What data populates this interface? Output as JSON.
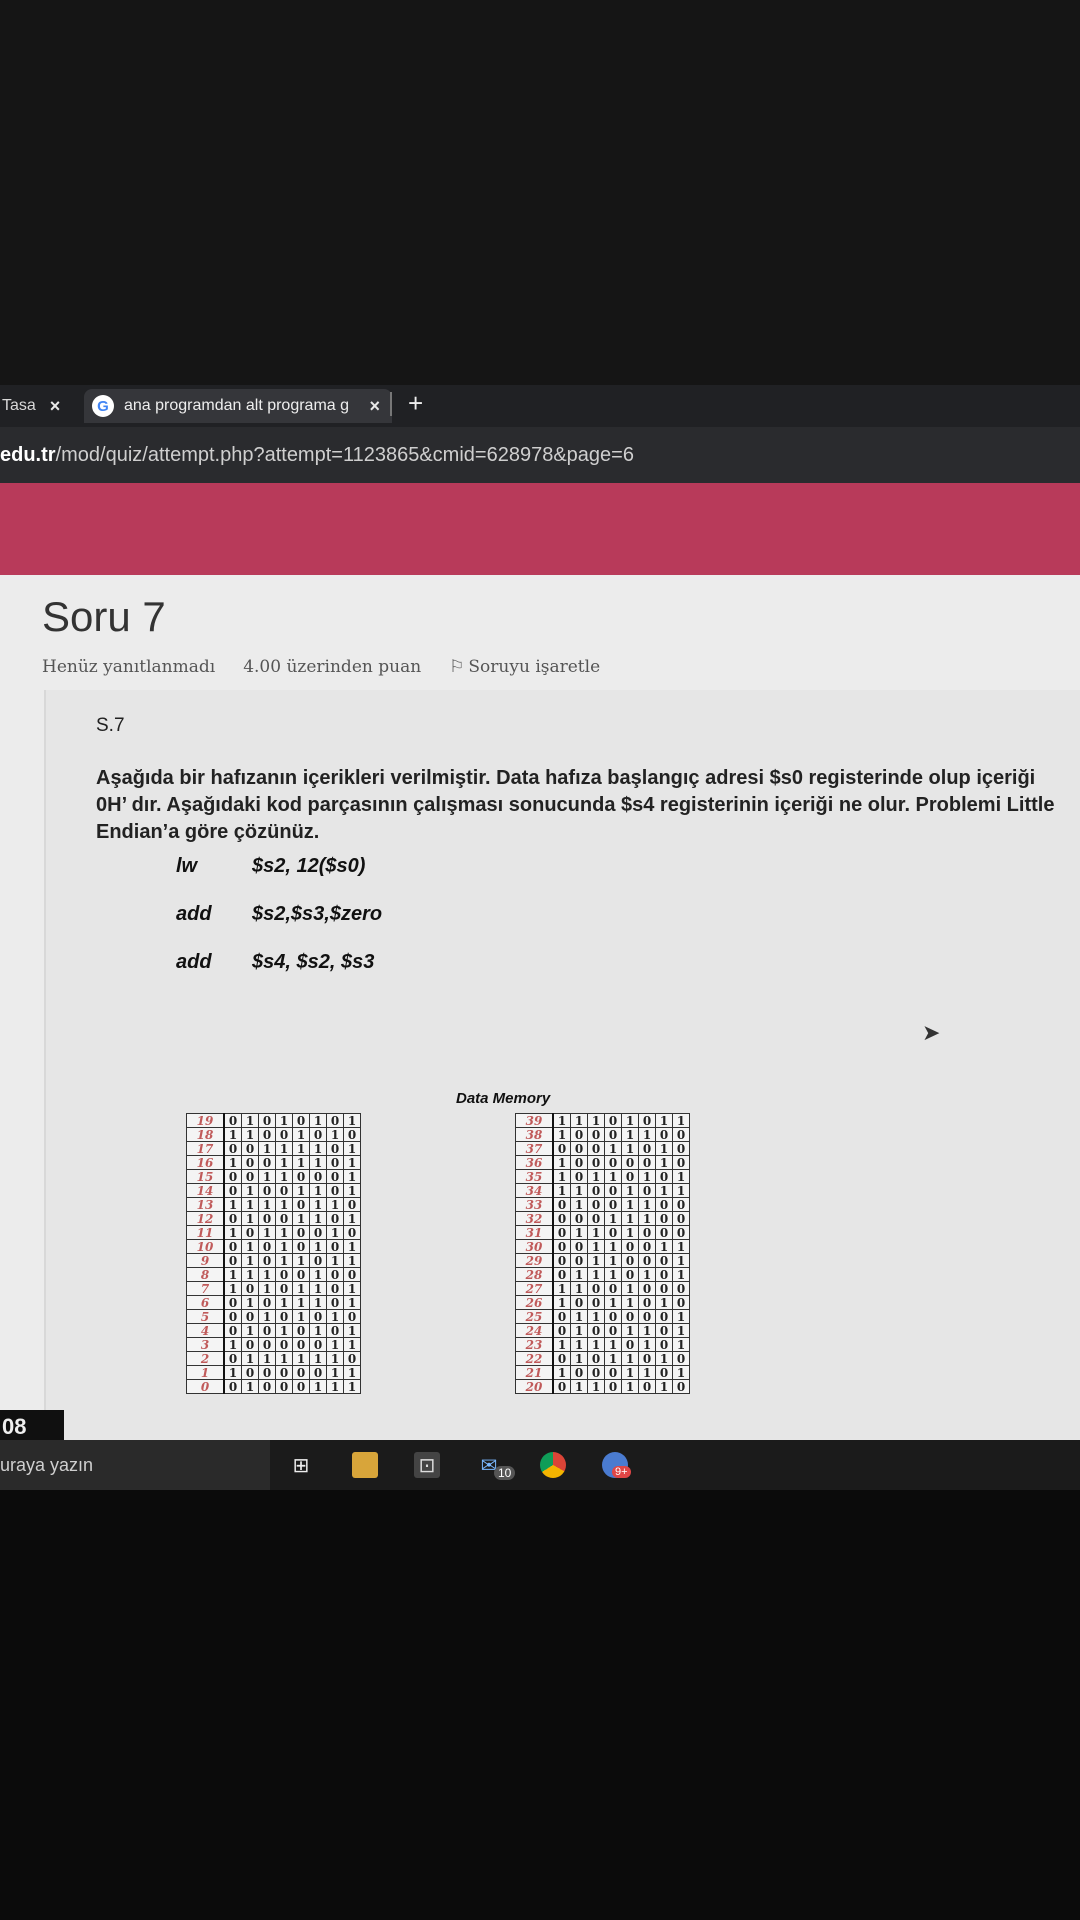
{
  "browser": {
    "tab1_label": "Tasa",
    "tab2_label": "ana programdan alt programa g",
    "close_glyph": "×",
    "new_tab_glyph": "+",
    "url_domain": "edu.tr",
    "url_path": "/mod/quiz/attempt.php?attempt=1123865&cmid=628978&page=6"
  },
  "quiz": {
    "title": "Soru 7",
    "status": "Henüz yanıtlanmadı",
    "points": "4.00 üzerinden puan",
    "flag": "Soruyu işaretle",
    "label": "S.7",
    "text": "Aşağıda bir hafızanın içerikleri verilmiştir. Data hafıza başlangıç adresi $s0 registerinde olup içeriği 0H’ dır. Aşağıdaki kod parçasının çalışması sonucunda $s4 registerinin içeriği ne olur. Problemi Little Endian’a göre çözünüz.",
    "code": [
      {
        "op": "lw",
        "args": "$s2, 12($s0)"
      },
      {
        "op": "add",
        "args": "$s2,$s3,$zero"
      },
      {
        "op": "add",
        "args": "$s4, $s2, $s3"
      }
    ]
  },
  "memory": {
    "title": "Data Memory",
    "left": [
      {
        "addr": "19",
        "bits": "01010101"
      },
      {
        "addr": "18",
        "bits": "11001010"
      },
      {
        "addr": "17",
        "bits": "00111101"
      },
      {
        "addr": "16",
        "bits": "10011101"
      },
      {
        "addr": "15",
        "bits": "00110001"
      },
      {
        "addr": "14",
        "bits": "01001101"
      },
      {
        "addr": "13",
        "bits": "11110110"
      },
      {
        "addr": "12",
        "bits": "01001101"
      },
      {
        "addr": "11",
        "bits": "10110010"
      },
      {
        "addr": "10",
        "bits": "01010101"
      },
      {
        "addr": "9",
        "bits": "01011011"
      },
      {
        "addr": "8",
        "bits": "11100100"
      },
      {
        "addr": "7",
        "bits": "10101101"
      },
      {
        "addr": "6",
        "bits": "01011101"
      },
      {
        "addr": "5",
        "bits": "00101010"
      },
      {
        "addr": "4",
        "bits": "01010101"
      },
      {
        "addr": "3",
        "bits": "10000011"
      },
      {
        "addr": "2",
        "bits": "01111110"
      },
      {
        "addr": "1",
        "bits": "10000011"
      },
      {
        "addr": "0",
        "bits": "01000111"
      }
    ],
    "right": [
      {
        "addr": "39",
        "bits": "11101011"
      },
      {
        "addr": "38",
        "bits": "10001100"
      },
      {
        "addr": "37",
        "bits": "00011010"
      },
      {
        "addr": "36",
        "bits": "10000010"
      },
      {
        "addr": "35",
        "bits": "10110101"
      },
      {
        "addr": "34",
        "bits": "11001011"
      },
      {
        "addr": "33",
        "bits": "01001100"
      },
      {
        "addr": "32",
        "bits": "00011100"
      },
      {
        "addr": "31",
        "bits": "01101000"
      },
      {
        "addr": "30",
        "bits": "00110011"
      },
      {
        "addr": "29",
        "bits": "00110001"
      },
      {
        "addr": "28",
        "bits": "01110101"
      },
      {
        "addr": "27",
        "bits": "11001000"
      },
      {
        "addr": "26",
        "bits": "10011010"
      },
      {
        "addr": "25",
        "bits": "01100001"
      },
      {
        "addr": "24",
        "bits": "01001101"
      },
      {
        "addr": "23",
        "bits": "11110101"
      },
      {
        "addr": "22",
        "bits": "01011010"
      },
      {
        "addr": "21",
        "bits": "10001101"
      },
      {
        "addr": "20",
        "bits": "01101010"
      }
    ]
  },
  "taskbar": {
    "left_text": "08",
    "search_placeholder": "uraya yazın",
    "mail_badge": "10",
    "chrome2_badge": "9+"
  }
}
